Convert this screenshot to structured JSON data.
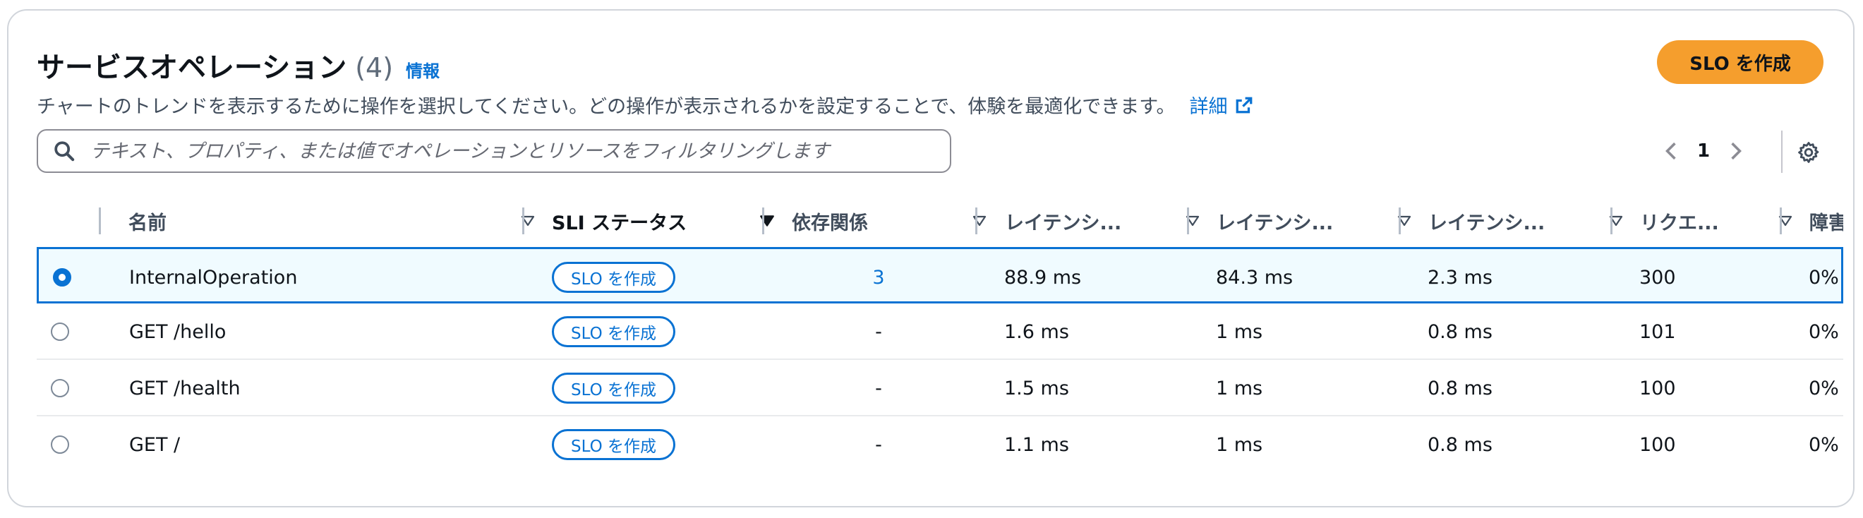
{
  "header": {
    "title": "サービスオペレーション",
    "count": "(4)",
    "info_link": "情報",
    "description": "チャートのトレンドを表示するために操作を選択してください。どの操作が表示されるかを設定することで、体験を最適化できます。",
    "detail_link": "詳細",
    "create_slo_button": "SLO を作成"
  },
  "search": {
    "placeholder": "テキスト、プロパティ、または値でオペレーションとリソースをフィルタリングします",
    "value": ""
  },
  "pagination": {
    "current_page": "1"
  },
  "table": {
    "columns": [
      "名前",
      "SLI ステータス",
      "依存関係",
      "レイテンシ...",
      "レイテンシ...",
      "レイテンシ...",
      "リクエ...",
      "障害"
    ],
    "rows": [
      {
        "selected": true,
        "name": "InternalOperation",
        "sli": "SLO を作成",
        "deps": "3",
        "lat1": "88.9 ms",
        "lat2": "84.3 ms",
        "lat3": "2.3 ms",
        "requests": "300",
        "faults": "0%"
      },
      {
        "selected": false,
        "name": "GET /hello",
        "sli": "SLO を作成",
        "deps": "-",
        "lat1": "1.6 ms",
        "lat2": "1 ms",
        "lat3": "0.8 ms",
        "requests": "101",
        "faults": "0%"
      },
      {
        "selected": false,
        "name": "GET /health",
        "sli": "SLO を作成",
        "deps": "-",
        "lat1": "1.5 ms",
        "lat2": "1 ms",
        "lat3": "0.8 ms",
        "requests": "100",
        "faults": "0%"
      },
      {
        "selected": false,
        "name": "GET /",
        "sli": "SLO を作成",
        "deps": "-",
        "lat1": "1.1 ms",
        "lat2": "1 ms",
        "lat3": "0.8 ms",
        "requests": "100",
        "faults": "0%"
      }
    ]
  },
  "colors": {
    "accent": "#0972d3",
    "primary_button": "#f59e2d",
    "selected_row_bg": "#f0fbff"
  },
  "icons": [
    "search-icon",
    "external-link-icon",
    "chevron-left-icon",
    "chevron-right-icon",
    "gear-icon",
    "sort-icon"
  ]
}
